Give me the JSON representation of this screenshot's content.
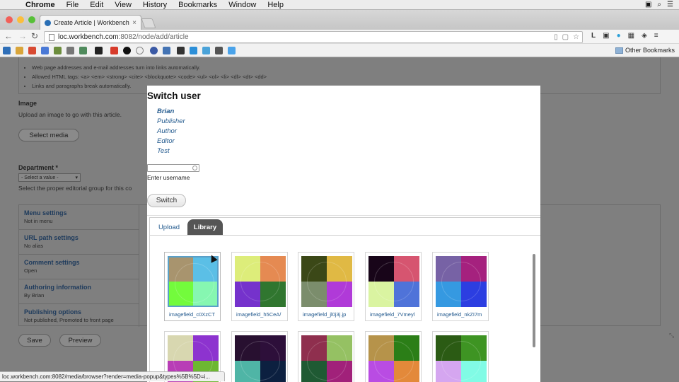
{
  "macmenu": {
    "apple": "",
    "app": "Chrome",
    "items": [
      "File",
      "Edit",
      "View",
      "History",
      "Bookmarks",
      "Window",
      "Help"
    ]
  },
  "browser": {
    "tab_title": "Create Article | Workbench",
    "url_host": "loc.workbench.com",
    "url_path": ":8082/node/add/article",
    "other_bookmarks": "Other Bookmarks",
    "status_url": "loc.workbench.com:8082/media/browser?render=media-popup&types%5B%5D=i..."
  },
  "page": {
    "tips": [
      "Web page addresses and e-mail addresses turn into links automatically.",
      "Allowed HTML tags: <a> <em> <strong> <cite> <blockquote> <code> <ul> <ol> <li> <dl> <dt> <dd>",
      "Links and paragraphs break automatically."
    ],
    "image_label": "Image",
    "image_desc": "Upload an image to go with this article.",
    "select_media": "Select media",
    "department_label": "Department *",
    "department_value": "- Select a value -",
    "department_desc": "Select the proper editorial group for this co",
    "vtabs": [
      {
        "title": "Menu settings",
        "summary": "Not in menu"
      },
      {
        "title": "URL path settings",
        "summary": "No alias"
      },
      {
        "title": "Comment settings",
        "summary": "Open"
      },
      {
        "title": "Authoring information",
        "summary": "By Brian"
      },
      {
        "title": "Publishing options",
        "summary": "Not published, Promoted to front page"
      }
    ],
    "save": "Save",
    "preview": "Preview"
  },
  "modal": {
    "title": "Switch user",
    "users": [
      "Brian",
      "Publisher",
      "Author",
      "Editor",
      "Test"
    ],
    "username_label": "Enter username",
    "switch_button": "Switch",
    "tabs": {
      "upload": "Upload",
      "library": "Library"
    },
    "images": [
      {
        "caption": "imagefield_c0XzCT",
        "colors": [
          "#a8946e",
          "#5bbfe6",
          "#73fb3c",
          "#86f7b1"
        ]
      },
      {
        "caption": "imagefield_h5CeA/",
        "colors": [
          "#dded7a",
          "#e58a52",
          "#7532cc",
          "#30762f"
        ]
      },
      {
        "caption": "imagefield_jl0j3j.jp",
        "colors": [
          "#3b4817",
          "#e0b944",
          "#7b8d6c",
          "#b03ad8"
        ]
      },
      {
        "caption": "imagefield_7Vmeyl",
        "colors": [
          "#180519",
          "#d65570",
          "#daf4a1",
          "#4f73d9"
        ]
      },
      {
        "caption": "imagefield_nkZI7m",
        "colors": [
          "#7762a5",
          "#a5217e",
          "#3599e1",
          "#2c3ee1"
        ]
      },
      {
        "caption": "",
        "colors": [
          "#d8d7b0",
          "#8d33cf",
          "#b83db6",
          "#6db731"
        ]
      },
      {
        "caption": "",
        "colors": [
          "#281030",
          "#2d0f3a",
          "#4fb5a6",
          "#0c2040"
        ]
      },
      {
        "caption": "",
        "colors": [
          "#8f2f4e",
          "#95c163",
          "#1f5a33",
          "#a1217a"
        ]
      },
      {
        "caption": "",
        "colors": [
          "#b6934a",
          "#2b7e17",
          "#b94ce3",
          "#e3893a"
        ]
      },
      {
        "caption": "",
        "colors": [
          "#2b5b14",
          "#3e9423",
          "#d5a6f0",
          "#81fbe5"
        ]
      }
    ]
  }
}
